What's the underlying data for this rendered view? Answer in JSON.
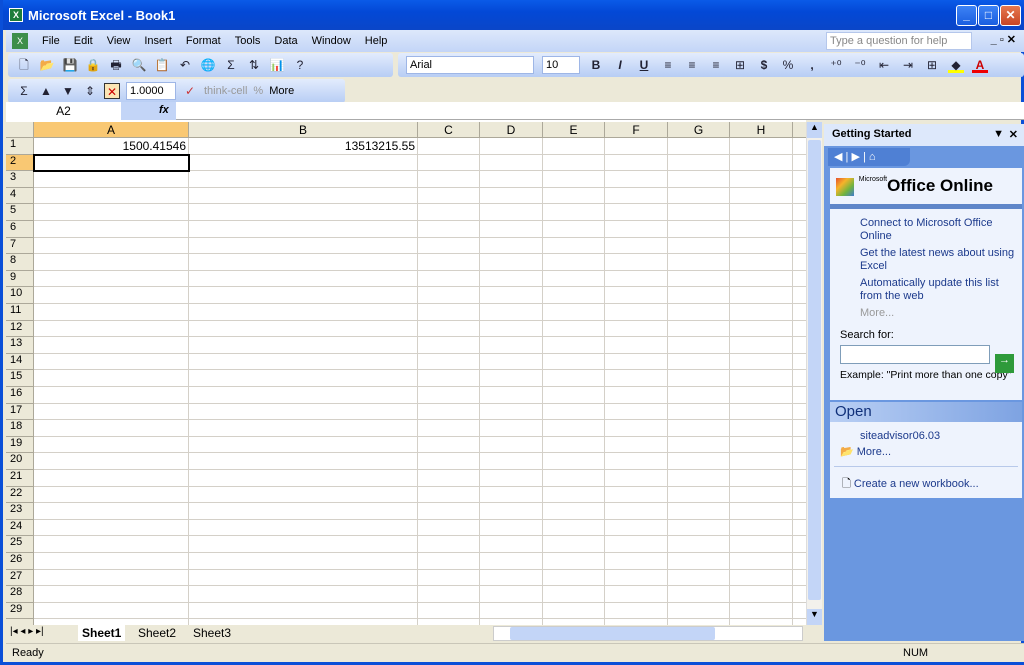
{
  "window": {
    "title": "Microsoft Excel - Book1",
    "min": "_",
    "max": "□",
    "close": "✕"
  },
  "menu": [
    "File",
    "Edit",
    "View",
    "Insert",
    "Format",
    "Tools",
    "Data",
    "Window",
    "Help"
  ],
  "help_placeholder": "Type a question for help",
  "format": {
    "font": "Arial",
    "size": "10",
    "bold": "B",
    "italic": "I",
    "underline": "U",
    "currency": "$",
    "percent": "%",
    "comma": ","
  },
  "thinkcell": {
    "value": "1.0000",
    "label": "think-cell",
    "percent": "%",
    "more": "More"
  },
  "formula": {
    "name_box": "A2",
    "fx": "fx",
    "value": ""
  },
  "grid": {
    "columns": [
      "A",
      "B",
      "C",
      "D",
      "E",
      "F",
      "G",
      "H"
    ],
    "rows": 29,
    "selected": "A2",
    "cells": [
      {
        "ref": "A1",
        "value": "1500.41546"
      },
      {
        "ref": "B1",
        "value": "13513215.55"
      }
    ]
  },
  "sheets": [
    "Sheet1",
    "Sheet2",
    "Sheet3"
  ],
  "active_sheet": "Sheet1",
  "status": {
    "text": "Ready",
    "num": "NUM"
  },
  "pane": {
    "title": "Getting Started",
    "logo_small": "Microsoft",
    "logo": "Office Online",
    "links": [
      "Connect to Microsoft Office Online",
      "Get the latest news about using Excel",
      "Automatically update this list from the web"
    ],
    "more": "More...",
    "search_label": "Search for:",
    "search_value": "",
    "example": "Example:  \"Print more than one copy\"",
    "open_title": "Open",
    "open_files": [
      "siteadvisor06.03"
    ],
    "open_more": "More...",
    "create": "Create a new workbook..."
  }
}
